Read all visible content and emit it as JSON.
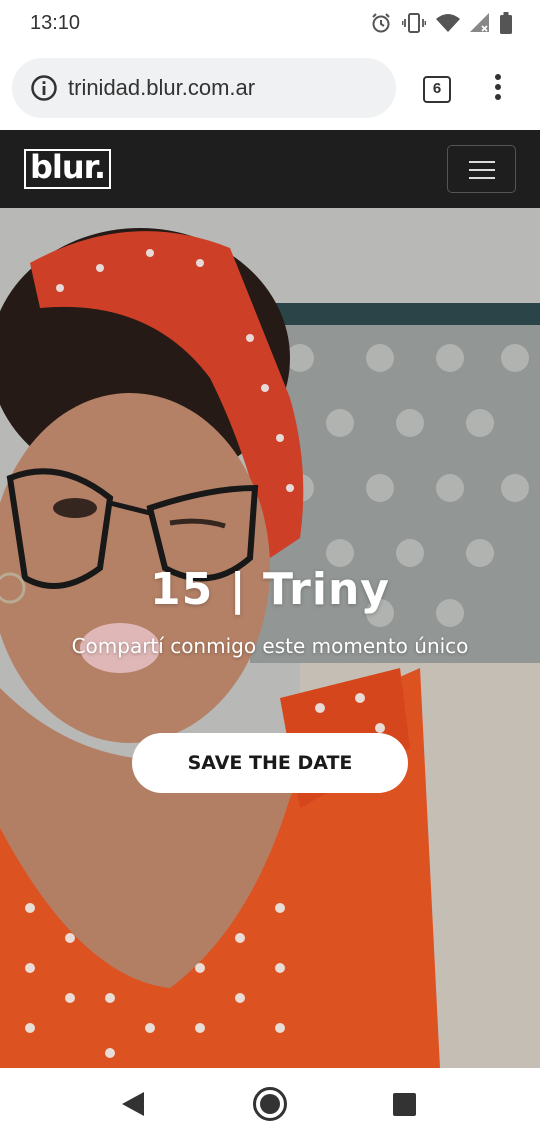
{
  "status_bar": {
    "time": "13:10",
    "icons": [
      "alarm-icon",
      "vibrate-icon",
      "wifi-icon",
      "signal-icon",
      "battery-icon"
    ]
  },
  "browser": {
    "url": "trinidad.blur.com.ar",
    "tab_count": "6",
    "info_icon": "info-icon",
    "menu_icon": "more-vert-icon"
  },
  "site_nav": {
    "logo_text": "blur.",
    "menu_icon": "hamburger-icon"
  },
  "hero": {
    "title": "15 | Triny",
    "subtitle": "Compartí conmigo este momento único",
    "cta_label": "SAVE THE DATE"
  },
  "android_nav": {
    "icons": [
      "back-icon",
      "home-icon",
      "recents-icon"
    ]
  },
  "colors": {
    "nav_background": "#1e1e1e",
    "hero_dress": "#f05a24",
    "button_background": "#ffffff"
  }
}
